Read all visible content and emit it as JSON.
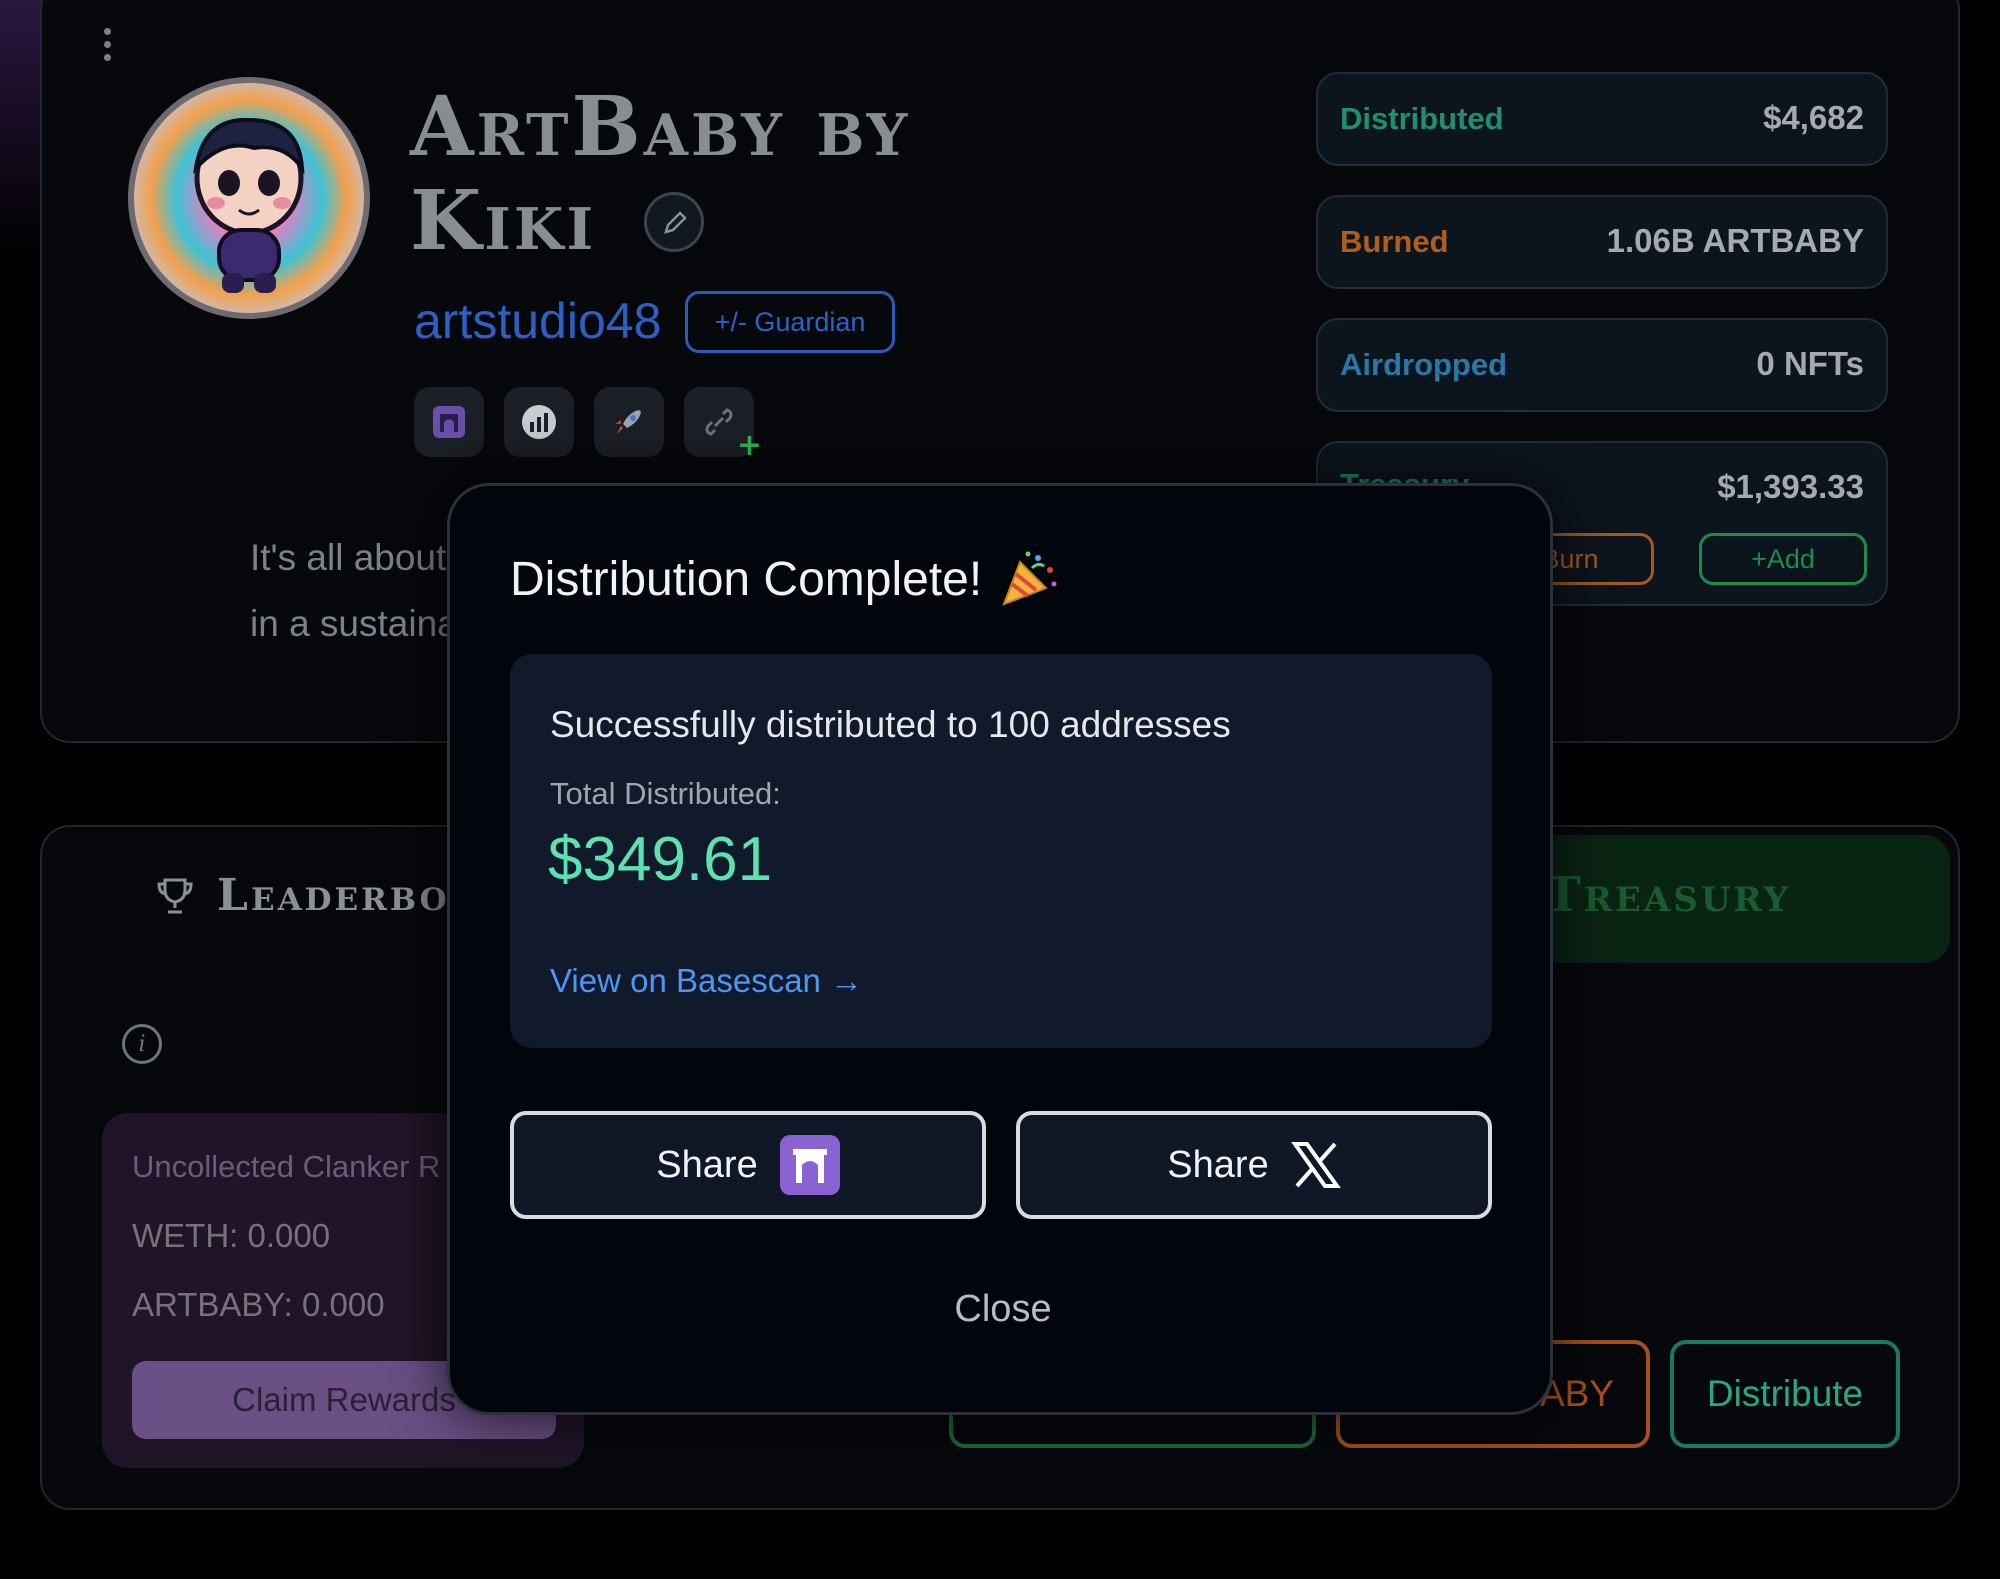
{
  "profile": {
    "title": "ArtBaby by Kiki",
    "username": "artstudio48",
    "guardian_label": "+/- Guardian",
    "bio_line1": "It's all about",
    "bio_line2": "in a sustaina"
  },
  "stats": {
    "distributed_label": "Distributed",
    "distributed_value": "$4,682",
    "burned_label": "Burned",
    "burned_value": "1.06B ARTBABY",
    "airdropped_label": "Airdropped",
    "airdropped_value": "0 NFTs",
    "treasury_label": "Treasury",
    "treasury_value": "$1,393.33",
    "burn_button": "Burn",
    "add_button": "+Add"
  },
  "tabs": {
    "leaderboard": "Leaderbo",
    "treasury": "Treasury"
  },
  "rewards": {
    "title": "Uncollected Clanker R",
    "weth": "WETH: 0.000",
    "artbaby": "ARTBABY: 0.000",
    "claim_button": "Claim Rewards"
  },
  "actions": {
    "burn_artbaby_partial": "ABY",
    "distribute": "Distribute"
  },
  "modal": {
    "title": "Distribution Complete!",
    "message": "Successfully distributed to 100 addresses",
    "total_label": "Total Distributed:",
    "total_value": "$349.61",
    "basescan_link": "View on Basescan →",
    "share_farcaster": "Share",
    "share_x": "Share",
    "close": "Close"
  },
  "colors": {
    "accent_green": "#5fe0b0",
    "link_blue": "#4d96f5",
    "farcaster_purple": "#8a63d2"
  }
}
